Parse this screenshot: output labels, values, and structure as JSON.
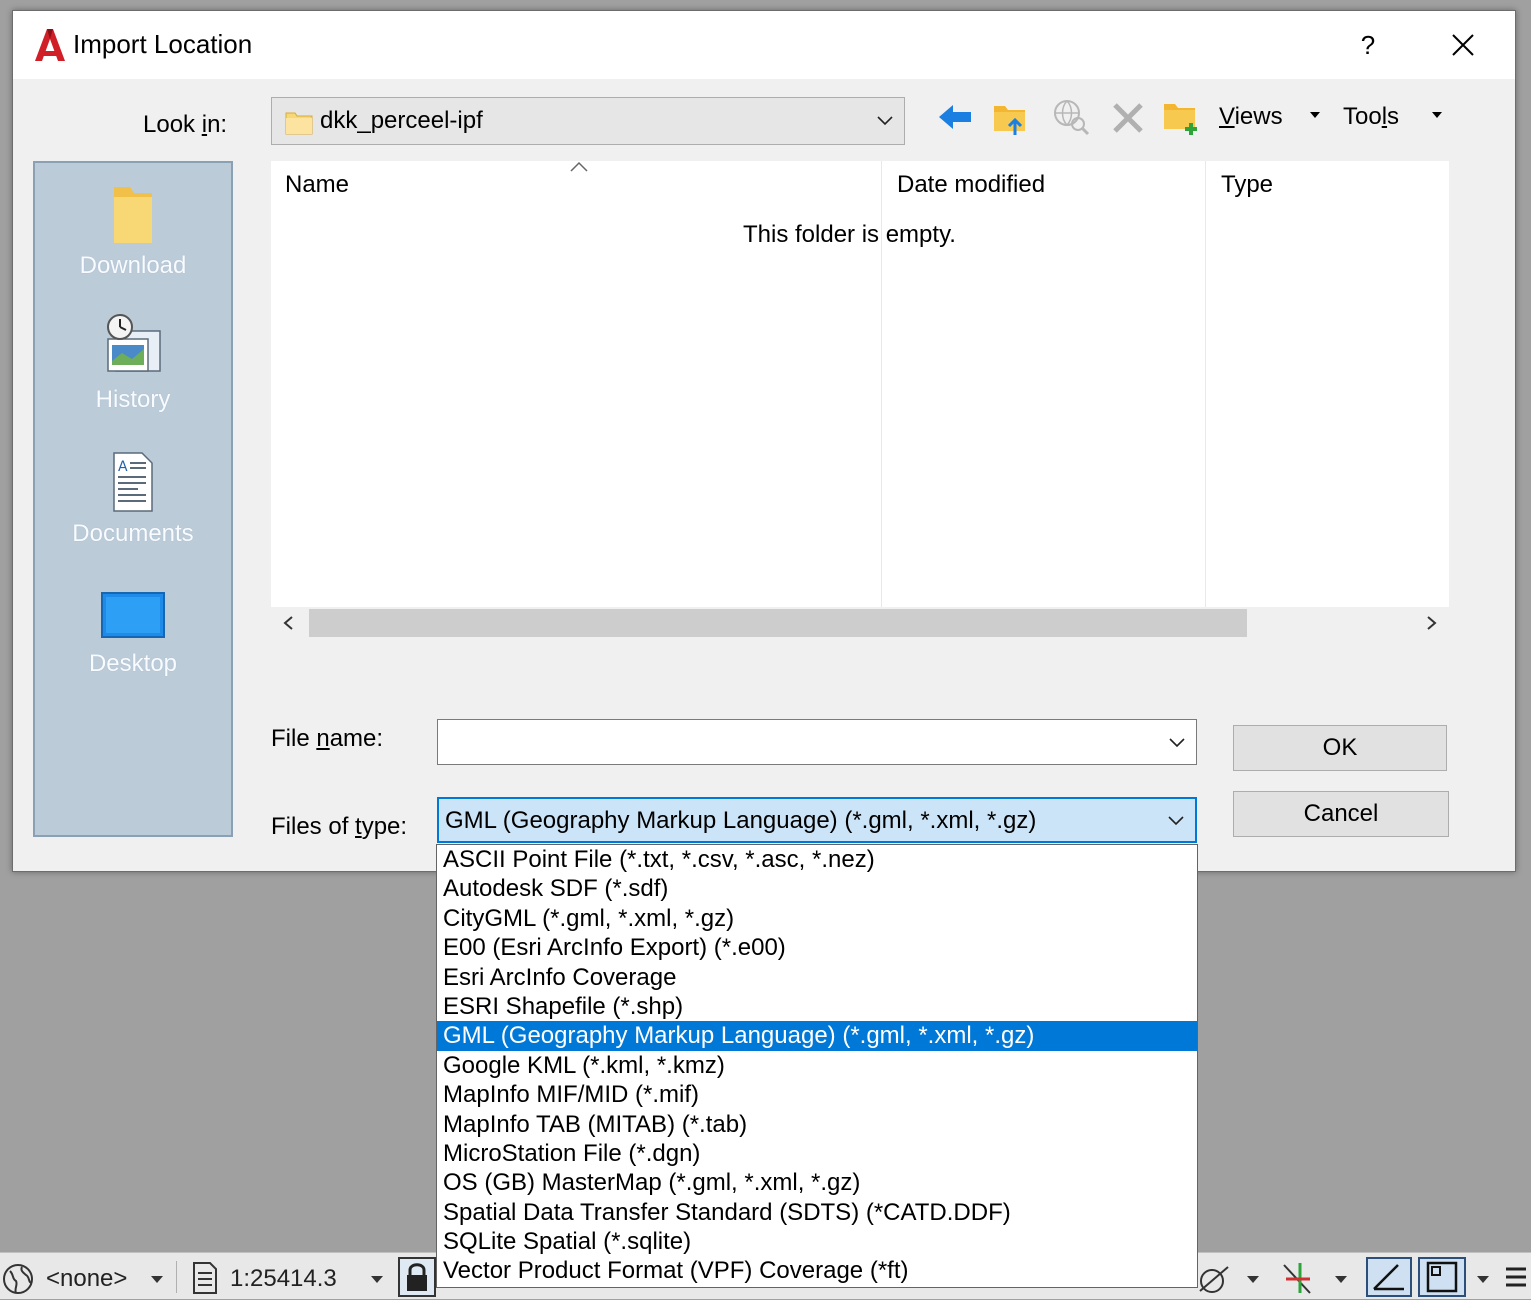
{
  "dialog": {
    "title": "Import Location",
    "help_label": "?"
  },
  "lookin": {
    "label_pre": "Look ",
    "label_key": "i",
    "label_post": "n:",
    "folder": "dkk_perceel-ipf"
  },
  "toolbar": {
    "views_label_key": "V",
    "views_label_rest": "iews",
    "tools_label_pre": "Too",
    "tools_label_key": "l",
    "tools_label_post": "s"
  },
  "places": [
    {
      "label": "Download",
      "icon": "folder-icon"
    },
    {
      "label": "History",
      "icon": "history-icon"
    },
    {
      "label": "Documents",
      "icon": "documents-icon"
    },
    {
      "label": "Desktop",
      "icon": "desktop-icon"
    }
  ],
  "filelist": {
    "columns": [
      "Name",
      "Date modified",
      "Type"
    ],
    "empty_message": "This folder is empty."
  },
  "filename": {
    "label_pre": "File ",
    "label_key": "n",
    "label_post": "ame:",
    "value": ""
  },
  "filetype": {
    "label_pre": "Files of ",
    "label_key": "t",
    "label_post": "ype:",
    "selected": "GML (Geography Markup Language) (*.gml, *.xml, *.gz)",
    "options": [
      "ASCII Point File  (*.txt, *.csv, *.asc, *.nez)",
      "Autodesk SDF  (*.sdf)",
      "CityGML (*.gml, *.xml, *.gz)",
      "E00 (Esri ArcInfo Export) (*.e00)",
      "Esri ArcInfo Coverage",
      "ESRI Shapefile  (*.shp)",
      "GML (Geography Markup Language) (*.gml, *.xml, *.gz)",
      "Google KML (*.kml, *.kmz)",
      "MapInfo MIF/MID (*.mif)",
      "MapInfo TAB (MITAB) (*.tab)",
      "MicroStation File  (*.dgn)",
      "OS (GB) MasterMap (*.gml, *.xml, *.gz)",
      "Spatial Data Transfer Standard (SDTS) (*CATD.DDF)",
      "SQLite Spatial  (*.sqlite)",
      "Vector Product Format (VPF) Coverage (*ft)"
    ],
    "selected_index": 6
  },
  "buttons": {
    "ok": "OK",
    "cancel": "Cancel"
  },
  "statusbar": {
    "coordinate_system": "<none>",
    "scale": "1:25414.3"
  },
  "colors": {
    "selection": "#0078d7",
    "places_bg": "#bccbd8",
    "dialog_bg": "#f0f0f0"
  }
}
